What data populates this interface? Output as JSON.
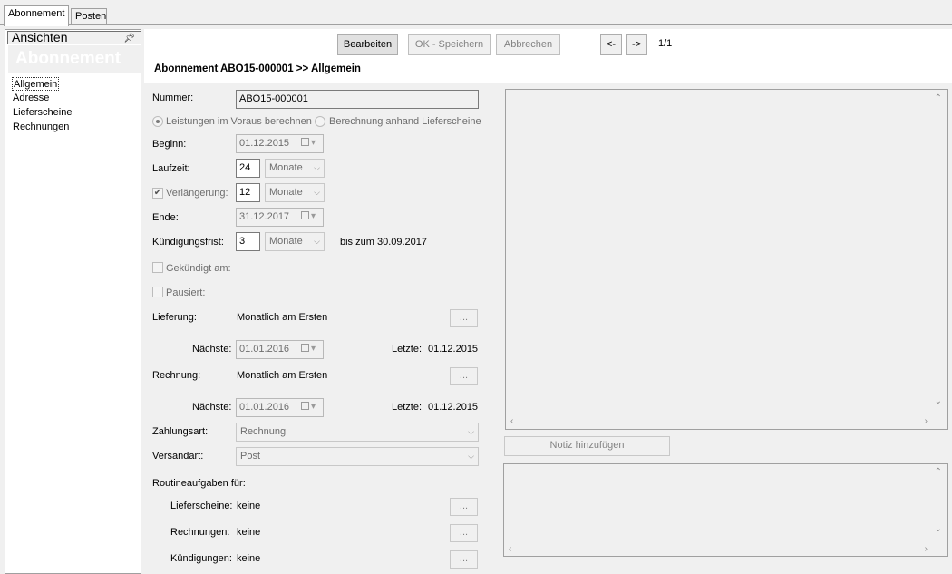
{
  "tabs": [
    {
      "label": "Abonnement",
      "active": true
    },
    {
      "label": "Posten",
      "active": false
    }
  ],
  "left_panel": {
    "header": "Ansichten",
    "pin_icon": "pin-icon",
    "title": "Abonnement",
    "items": [
      {
        "label": "Allgemein",
        "selected": true
      },
      {
        "label": "Adresse"
      },
      {
        "label": "Lieferscheine"
      },
      {
        "label": "Rechnungen"
      }
    ]
  },
  "toolbar": {
    "edit_label": "Bearbeiten",
    "save_label": "OK - Speichern",
    "cancel_label": "Abbrechen",
    "prev_label": "<-",
    "next_label": "->",
    "page_indicator": "1/1"
  },
  "breadcrumb": "Abonnement ABO15-000001 >> Allgemein",
  "form": {
    "nummer_label": "Nummer:",
    "nummer_value": "ABO15-000001",
    "radio_voraus": "Leistungen im Voraus berechnen",
    "radio_lieferscheine": "Berechnung anhand Lieferscheine",
    "beginn_label": "Beginn:",
    "beginn_value": "01.12.2015",
    "laufzeit_label": "Laufzeit:",
    "laufzeit_value": "24",
    "laufzeit_unit": "Monate",
    "verlaengerung_label": "Verlängerung:",
    "verlaengerung_value": "12",
    "verlaengerung_unit": "Monate",
    "ende_label": "Ende:",
    "ende_value": "31.12.2017",
    "kuendigungsfrist_label": "Kündigungsfrist:",
    "kuendigungsfrist_value": "3",
    "kuendigungsfrist_unit": "Monate",
    "kuendigungsfrist_bis": "bis zum 30.09.2017",
    "gekuendigt_label": "Gekündigt am:",
    "pausiert_label": "Pausiert:",
    "lieferung_label": "Lieferung:",
    "lieferung_value": "Monatlich am Ersten",
    "lieferung_naechste_label": "Nächste:",
    "lieferung_naechste_value": "01.01.2016",
    "lieferung_letzte_label": "Letzte:",
    "lieferung_letzte_value": "01.12.2015",
    "rechnung_label": "Rechnung:",
    "rechnung_value": "Monatlich am Ersten",
    "rechnung_naechste_label": "Nächste:",
    "rechnung_naechste_value": "01.01.2016",
    "rechnung_letzte_label": "Letzte:",
    "rechnung_letzte_value": "01.12.2015",
    "zahlungsart_label": "Zahlungsart:",
    "zahlungsart_value": "Rechnung",
    "versandart_label": "Versandart:",
    "versandart_value": "Post",
    "routine_label": "Routineaufgaben für:",
    "routine_lieferscheine_label": "Lieferscheine:",
    "routine_lieferscheine_value": "keine",
    "routine_rechnungen_label": "Rechnungen:",
    "routine_rechnungen_value": "keine",
    "routine_kuendigungen_label": "Kündigungen:",
    "routine_kuendigungen_value": "keine",
    "dots_label": "..."
  },
  "notes": {
    "add_note_label": "Notiz hinzufügen"
  }
}
